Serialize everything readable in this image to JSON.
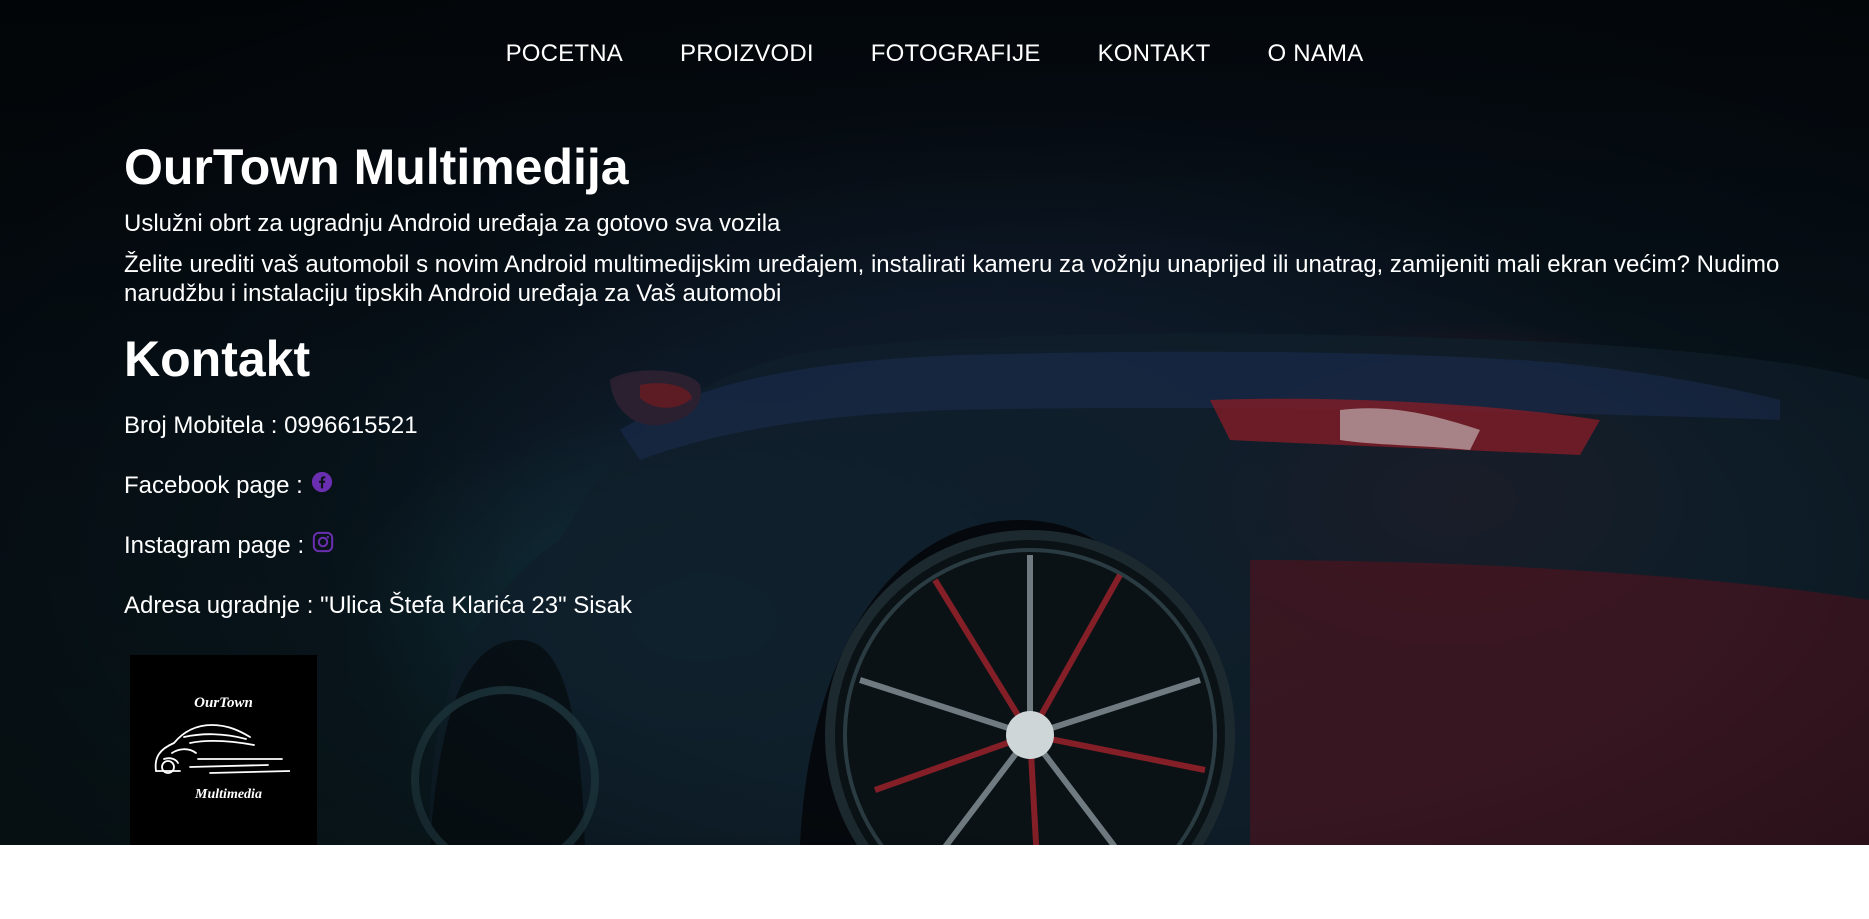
{
  "nav": {
    "items": [
      "POCETNA",
      "PROIZVODI",
      "FOTOGRAFIJE",
      "KONTAKT",
      "O NAMA"
    ]
  },
  "hero": {
    "title": "OurTown Multimedija",
    "subtitle": "Uslužni obrt za ugradnju Android uređaja za gotovo sva vozila",
    "description": "Želite urediti vaš automobil s novim Android multimedijskim uređajem, instalirati kameru za vožnju unaprijed ili unatrag, zamijeniti mali ekran većim? Nudimo narudžbu i instalaciju tipskih Android uređaja za Vaš automobi"
  },
  "kontakt": {
    "heading": "Kontakt",
    "phone_label": "Broj Mobitela : 0996615521",
    "facebook_label": "Facebook page :",
    "instagram_label": "Instagram page :",
    "address_label": "Adresa ugradnje : \"Ulica Štefa Klarića 23\" Sisak",
    "icon_color": "#6a2fb0"
  },
  "logo": {
    "top_text": "OurTown",
    "bottom_text": "Multimedia"
  },
  "icons": {
    "facebook": "facebook-icon",
    "instagram": "instagram-icon"
  }
}
